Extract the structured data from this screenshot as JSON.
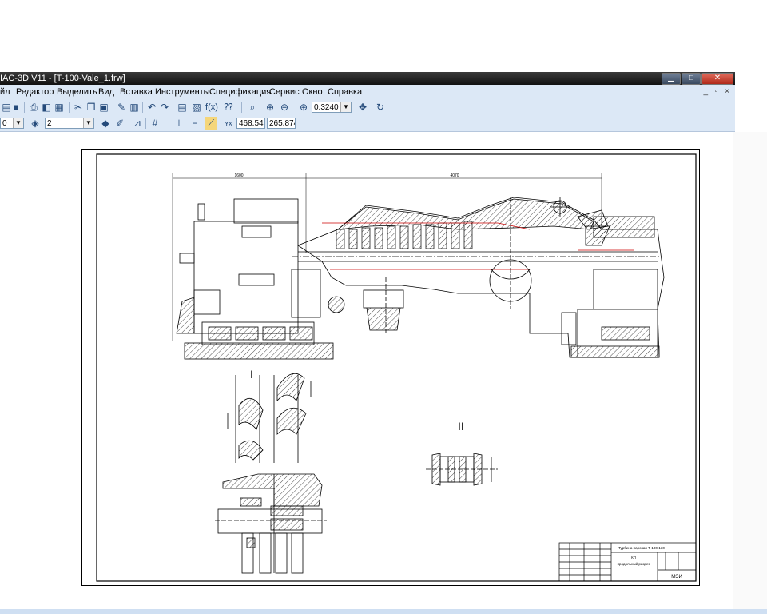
{
  "window": {
    "title": "IAC-3D V11 - [T-100-Vale_1.frw]",
    "btn_min": "▁",
    "btn_max": "□",
    "btn_close": "✕",
    "mdi_controls": "_ ▫ ×"
  },
  "menu": {
    "items": [
      "йл",
      "Редактор",
      "Выделить",
      "Вид",
      "Вставка",
      "Инструменты",
      "Спецификация",
      "Сервис",
      "Окно",
      "Справка"
    ]
  },
  "toolbar1": {
    "zoom_value": "0.3240"
  },
  "toolbar2": {
    "layer_value": "0",
    "style_value": "2",
    "coord_x": "468.546",
    "coord_y": "265.874"
  },
  "drawing": {
    "dim_left": "1600",
    "dim_right": "4070",
    "view_label_1": "I",
    "view_label_2": "II",
    "title_block": {
      "name_line": "Турбина паровая Т-100-130",
      "doc_line1": "КП",
      "doc_line2": "продольный разрез",
      "org": "МЭИ"
    }
  },
  "colors": {
    "accent": "#dce8f6",
    "titlebar": "#1a1a1a",
    "section_red": "#cc0000"
  }
}
